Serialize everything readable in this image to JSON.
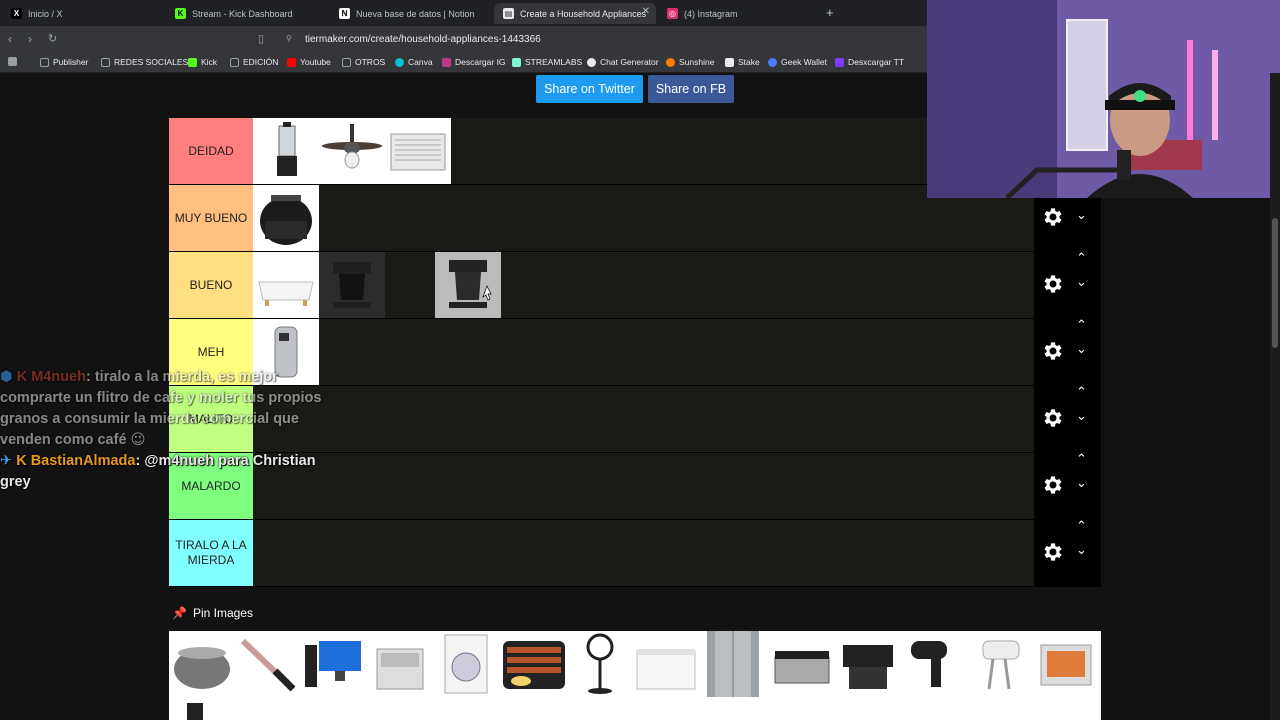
{
  "tabs": [
    {
      "title": "Inicio / X",
      "icon": "x-logo-icon",
      "color": "#000000"
    },
    {
      "title": "Stream - Kick Dashboard",
      "icon": "kick-icon",
      "color": "#53fc18"
    },
    {
      "title": "Nueva base de datos | Notion",
      "icon": "notion-icon",
      "color": "#ffffff"
    },
    {
      "title": "Create a Household Appliances",
      "icon": "tiermaker-icon",
      "color": "#e8eaed"
    },
    {
      "title": "(4) Instagram",
      "icon": "instagram-icon",
      "color": "#e1306c"
    }
  ],
  "address": {
    "url": "tiermaker.com/create/household-appliances-1443366"
  },
  "bookmarks": [
    {
      "label": "Publisher",
      "color": "#9aa0a6"
    },
    {
      "label": "REDES SOCIALES",
      "color": "#9aa0a6"
    },
    {
      "label": "Kick",
      "color": "#53fc18"
    },
    {
      "label": "EDICIÓN",
      "color": "#9aa0a6"
    },
    {
      "label": "Youtube",
      "color": "#ff0000"
    },
    {
      "label": "OTROS",
      "color": "#9aa0a6"
    },
    {
      "label": "Canva",
      "color": "#00c4cc"
    },
    {
      "label": "Descargar IG",
      "color": "#c13584"
    },
    {
      "label": "STREAMLABS",
      "color": "#80f5d2"
    },
    {
      "label": "Chat Generator",
      "color": "#e8eaed"
    },
    {
      "label": "Sunshine",
      "color": "#ff7a00"
    },
    {
      "label": "Stake",
      "color": "#e8eaed"
    },
    {
      "label": "Geek Wallet",
      "color": "#4b7bff"
    },
    {
      "label": "Desxcargar TT",
      "color": "#7b3cff"
    }
  ],
  "share": {
    "twitter": "Share on Twitter",
    "fb": "Share on FB"
  },
  "tiers": [
    {
      "label": "DEIDAD",
      "color": "#ff7f7f"
    },
    {
      "label": "MUY BUENO",
      "color": "#ffbf7f"
    },
    {
      "label": "BUENO",
      "color": "#ffdf7f"
    },
    {
      "label": "MEH",
      "color": "#ffff7f"
    },
    {
      "label": "MALITO",
      "color": "#bfff7f"
    },
    {
      "label": "MALARDO",
      "color": "#7fff7f"
    },
    {
      "label": "TIRALO A LA MIERDA",
      "color": "#7fffff"
    }
  ],
  "pin": {
    "label": "Pin Images"
  },
  "chat": {
    "msg1_user": "M4nueh",
    "msg1_text": ": tiralo a la mierda, es mejor comprarte un flitro de cafe y moler tus propios granos a consumir la mierda comercial que venden como café 😉",
    "msg2_user": "BastianAlmada",
    "msg2_text": ": @m4nueh para Christian grey"
  }
}
